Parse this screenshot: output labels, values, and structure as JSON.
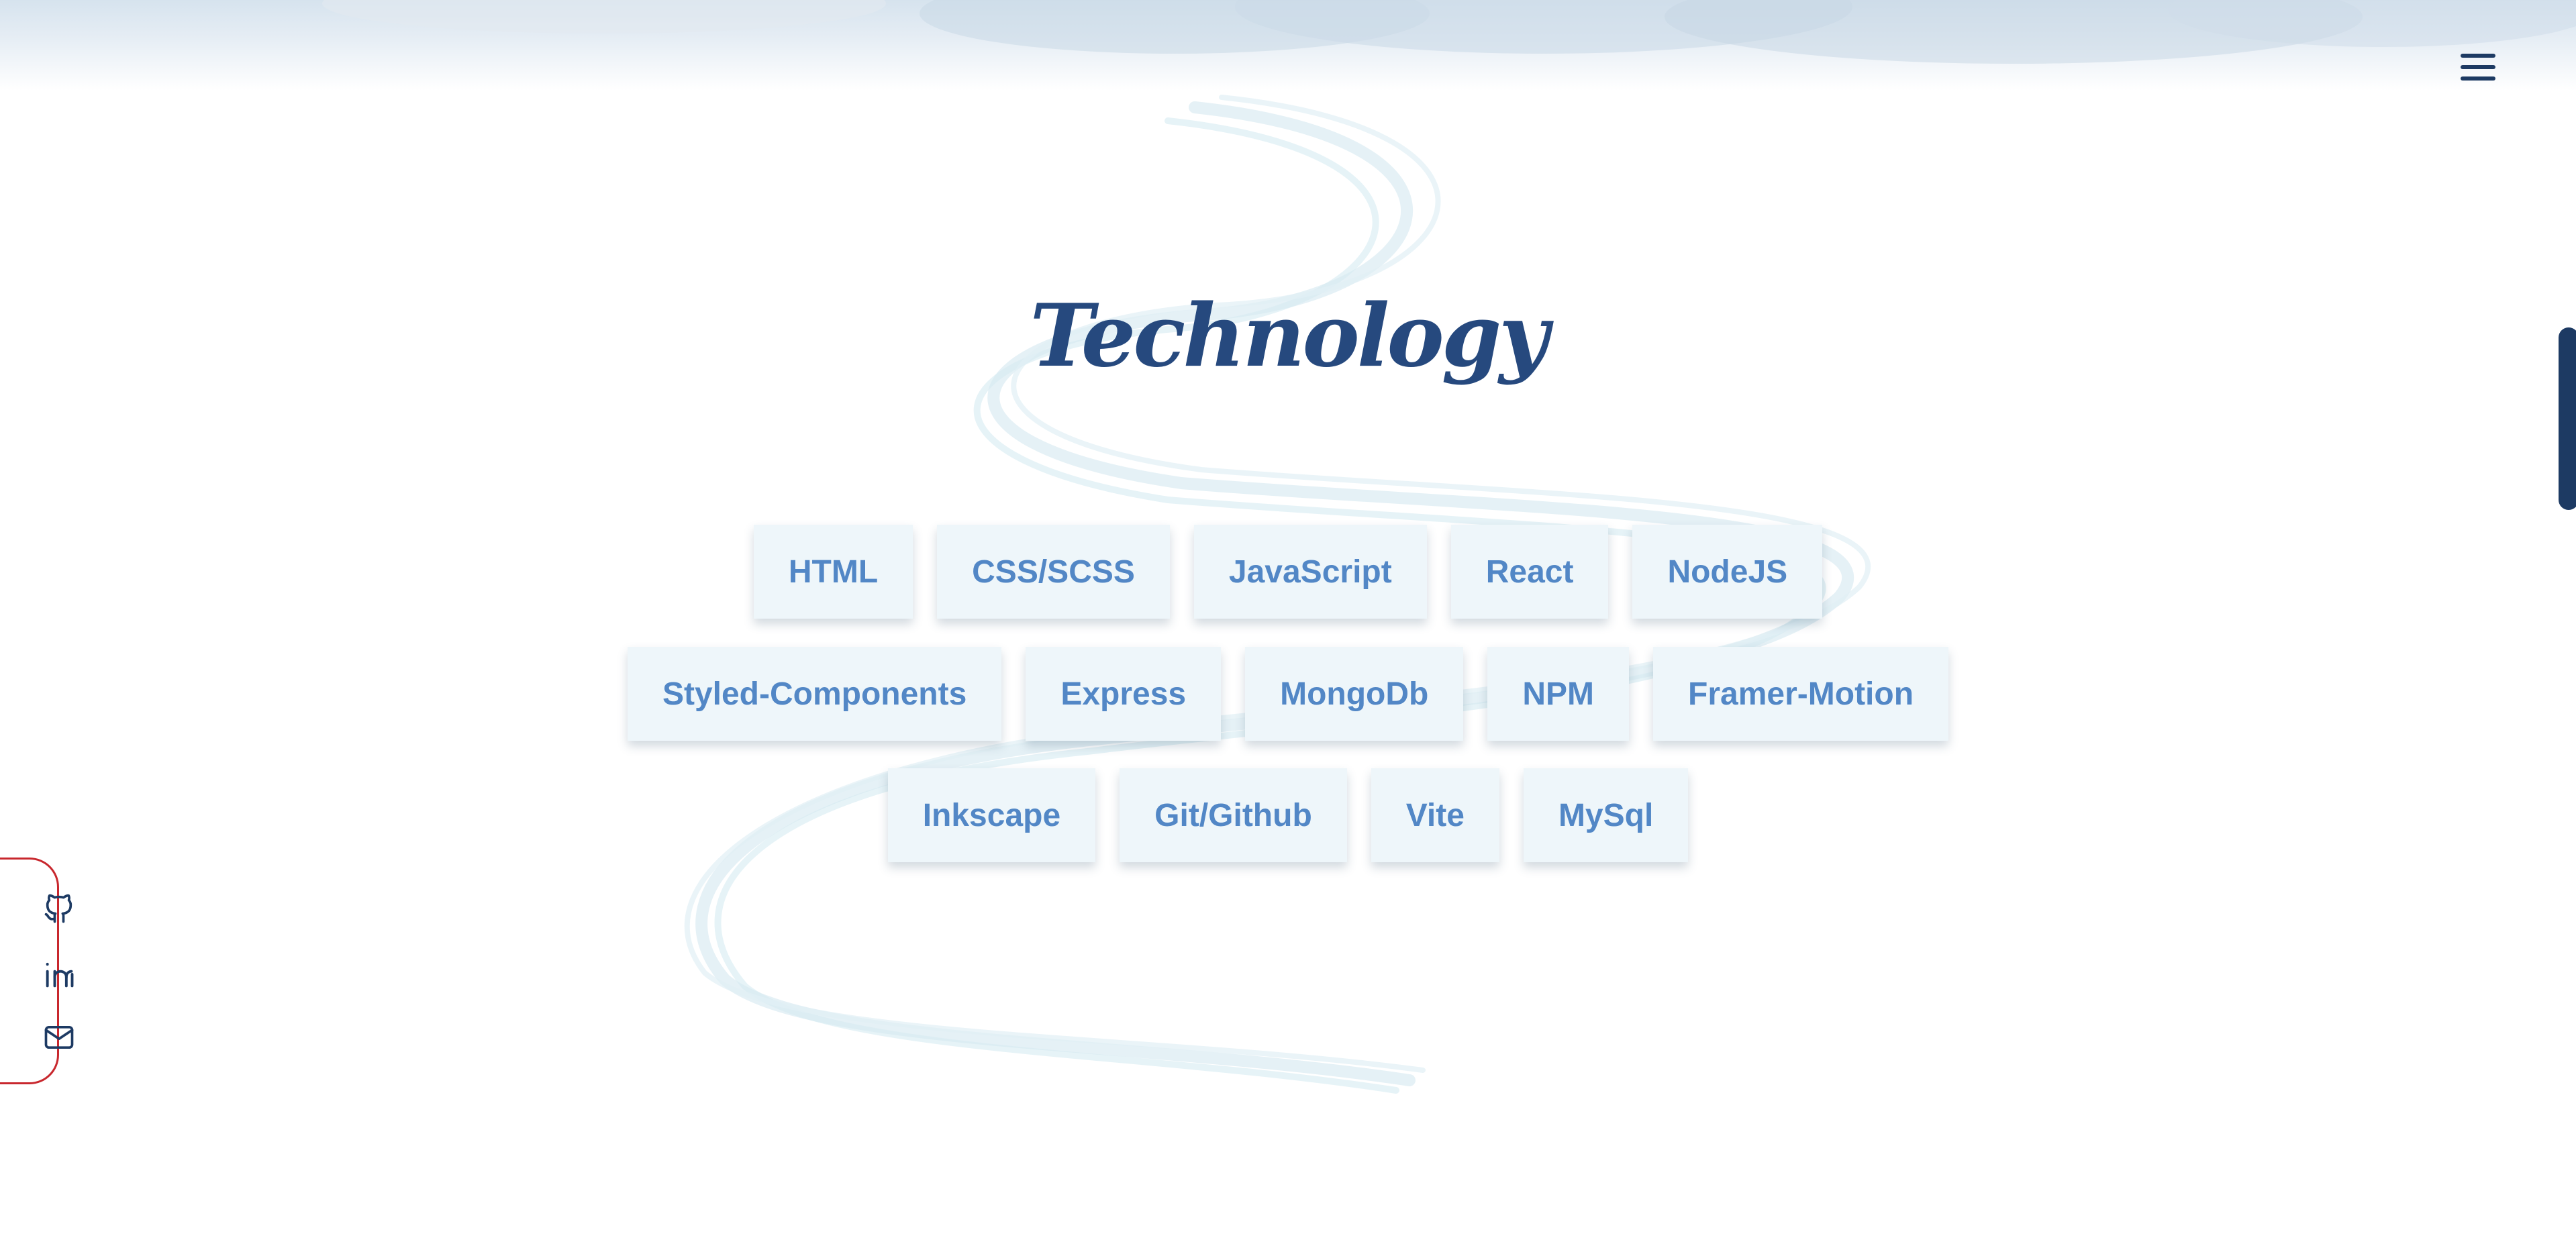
{
  "header": {
    "menu_icon": "hamburger-menu-icon"
  },
  "section": {
    "title": "Technology"
  },
  "technologies": {
    "rows": [
      [
        "HTML",
        "CSS/SCSS",
        "JavaScript",
        "React",
        "NodeJS"
      ],
      [
        "Styled-Components",
        "Express",
        "MongoDb",
        "NPM",
        "Framer-Motion"
      ],
      [
        "Inkscape",
        "Git/Github",
        "Vite",
        "MySql"
      ]
    ]
  },
  "social": {
    "icons": [
      "github-icon",
      "linkedin-icon",
      "mail-icon"
    ]
  },
  "colors": {
    "title": "#26497e",
    "chip_text": "#5287c6",
    "chip_background": "#eef6fa",
    "navy": "#1d3a63",
    "accent_red": "#c8272d"
  }
}
